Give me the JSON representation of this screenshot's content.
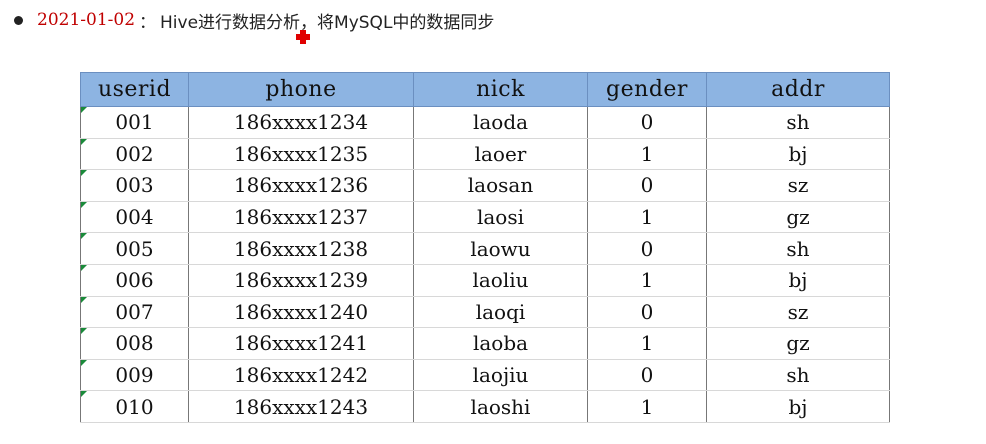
{
  "bullet": {
    "date": "2021-01-02",
    "separator": "：",
    "description": "Hive进行数据分析，将MySQL中的数据同步"
  },
  "table": {
    "headers": [
      "userid",
      "phone",
      "nick",
      "gender",
      "addr"
    ],
    "rows": [
      [
        "001",
        "186xxxx1234",
        "laoda",
        "0",
        "sh"
      ],
      [
        "002",
        "186xxxx1235",
        "laoer",
        "1",
        "bj"
      ],
      [
        "003",
        "186xxxx1236",
        "laosan",
        "0",
        "sz"
      ],
      [
        "004",
        "186xxxx1237",
        "laosi",
        "1",
        "gz"
      ],
      [
        "005",
        "186xxxx1238",
        "laowu",
        "0",
        "sh"
      ],
      [
        "006",
        "186xxxx1239",
        "laoliu",
        "1",
        "bj"
      ],
      [
        "007",
        "186xxxx1240",
        "laoqi",
        "0",
        "sz"
      ],
      [
        "008",
        "186xxxx1241",
        "laoba",
        "1",
        "gz"
      ],
      [
        "009",
        "186xxxx1242",
        "laojiu",
        "0",
        "sh"
      ],
      [
        "010",
        "186xxxx1243",
        "laoshi",
        "1",
        "bj"
      ]
    ]
  },
  "colors": {
    "date": "#c00000",
    "header_bg": "#8db4e2",
    "cursor": "#e00000"
  }
}
